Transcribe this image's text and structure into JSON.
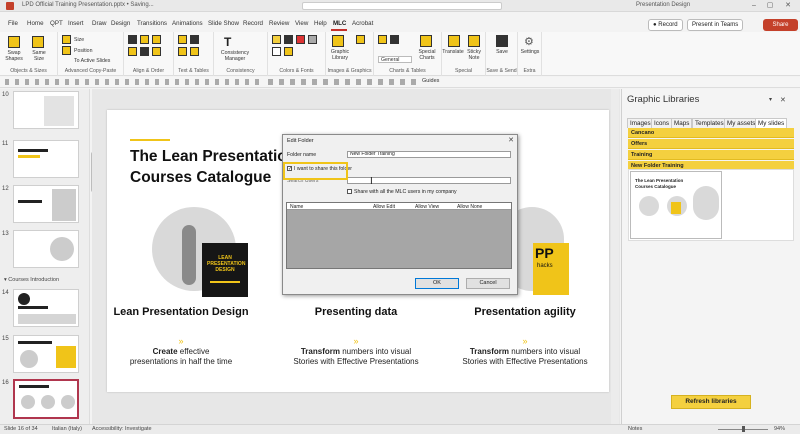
{
  "titlebar": {
    "document": "LPD Official Training Presentation.pptx • Saving...",
    "user": "Presentation Design",
    "min": "–",
    "max": "▢",
    "close": "✕"
  },
  "menu": [
    "File",
    "Home",
    "QPT",
    "Insert",
    "Draw",
    "Design",
    "Transitions",
    "Animations",
    "Slide Show",
    "Record",
    "Review",
    "View",
    "Help",
    "MLC",
    "Acrobat"
  ],
  "topbuttons": {
    "record": "Record",
    "present": "Present in Teams",
    "share": "Share"
  },
  "ribbon": {
    "groups": [
      "Objects & Sizes",
      "Advanced Copy-Paste",
      "Align & Order",
      "Text & Tables",
      "Consistency",
      "Colors & Fonts",
      "Images & Graphics",
      "Charts & Tables",
      "Special",
      "Save & Send",
      "Extra"
    ],
    "swap_shapes": "Swap Shapes",
    "same_size": "Same Size",
    "size": "Size",
    "position": "Position",
    "to_active_slides": "To Active Slides",
    "consistency_manager": "Consistency Manager",
    "graphic_library": "Graphic Library",
    "general": "General",
    "special_charts": "Special Charts",
    "translate": "Translate",
    "sticky_note": "Sticky Note",
    "save": "Save",
    "settings": "Settings",
    "guides": "Guides"
  },
  "thumbnails": {
    "numbers": [
      "10",
      "11",
      "12",
      "13",
      "14",
      "15",
      "16"
    ],
    "section": "Courses Introduction"
  },
  "slide": {
    "title_line1": "The Lean Presentation",
    "title_line2": "Courses Catalogue",
    "book_text": "LEAN PRESENTATION DESIGN",
    "pp_text": "PP",
    "hacks_text": "hacks",
    "columns": [
      {
        "title": "Lean Presentation Design",
        "verb": "Create",
        "desc1": " effective",
        "desc2": "presentations in half the time"
      },
      {
        "title": "Presenting data",
        "verb": "Transform",
        "desc1": " numbers into visual",
        "desc2": "Stories with Effective Presentations"
      },
      {
        "title": "Presentation agility",
        "verb": "Transform",
        "desc1": " numbers into visual",
        "desc2": "Stories with Effective Presentations"
      }
    ],
    "arrow": "»"
  },
  "dialog": {
    "title": "Edit Folder",
    "close": "✕",
    "folder_name_label": "Folder name",
    "folder_name_value": "New Folder Training",
    "share_checkbox": "I want to share this folder",
    "search_users": "Search Users",
    "share_all": "Share with all the MLC users in my company",
    "grid_headers": [
      "Name",
      "Allow Edit",
      "Allow View",
      "Allow None"
    ],
    "ok": "OK",
    "cancel": "Cancel",
    "check": "✓"
  },
  "pane": {
    "title": "Graphic Libraries",
    "close": "✕",
    "tabs": [
      "Images",
      "Icons",
      "Maps",
      "Templates",
      "My assets",
      "My slides"
    ],
    "folders": [
      "Cancano",
      "Offers",
      "Training",
      "New Folder Training"
    ],
    "thumb_title": "The Lean Presentation Courses Catalogue",
    "refresh": "Refresh libraries"
  },
  "status": {
    "slide": "Slide 16 of 34",
    "language": "Italian (Italy)",
    "accessibility": "Accessibility: Investigate",
    "notes": "Notes",
    "zoom": "94%"
  },
  "colors": {
    "accent": "#f0c419",
    "share": "#c4402a",
    "selected_thumb": "#b0364e"
  }
}
